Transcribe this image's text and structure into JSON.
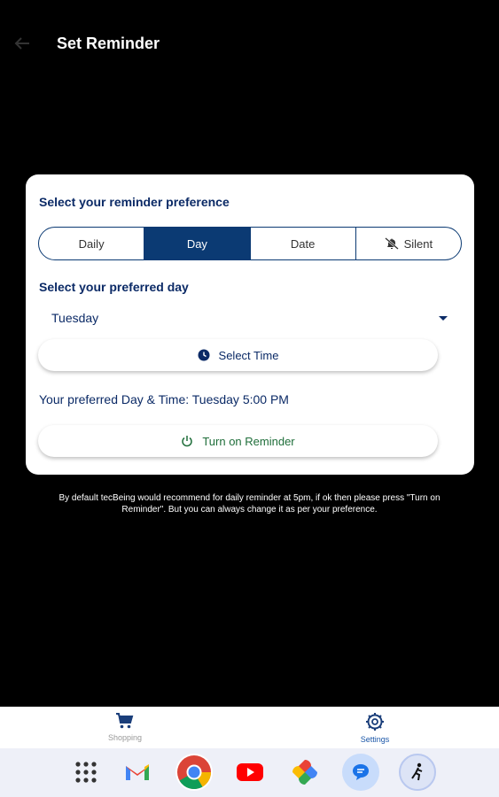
{
  "header": {
    "title": "Set Reminder"
  },
  "card": {
    "heading": "Select your reminder preference",
    "segments": [
      {
        "label": "Daily",
        "active": false
      },
      {
        "label": "Day",
        "active": true
      },
      {
        "label": "Date",
        "active": false
      },
      {
        "label": "Silent",
        "active": false
      }
    ],
    "day_heading": "Select your preferred day",
    "selected_day": "Tuesday",
    "select_time_label": "Select Time",
    "preferred_text": "Your preferred Day & Time: Tuesday 5:00 PM",
    "reminder_button_label": "Turn on Reminder"
  },
  "footnote": "By default tecBeing would recommend for daily reminder at 5pm, if ok then please press \"Turn on Reminder\". But you can always change it as per your preference.",
  "bottom_nav": {
    "items": [
      {
        "label": "Shopping",
        "icon": "cart-icon",
        "active": false
      },
      {
        "label": "Settings",
        "icon": "gear-icon",
        "active": true
      }
    ]
  },
  "dock": {
    "apps": [
      "apps-grid-icon",
      "gmail-icon",
      "chrome-icon",
      "youtube-icon",
      "photos-icon",
      "messages-icon",
      "fitness-app-icon"
    ]
  },
  "colors": {
    "primary": "#0b3a73",
    "heading": "#0b2a66",
    "reminder_green": "#1f6e3a",
    "settings_blue": "#1a56a8"
  }
}
